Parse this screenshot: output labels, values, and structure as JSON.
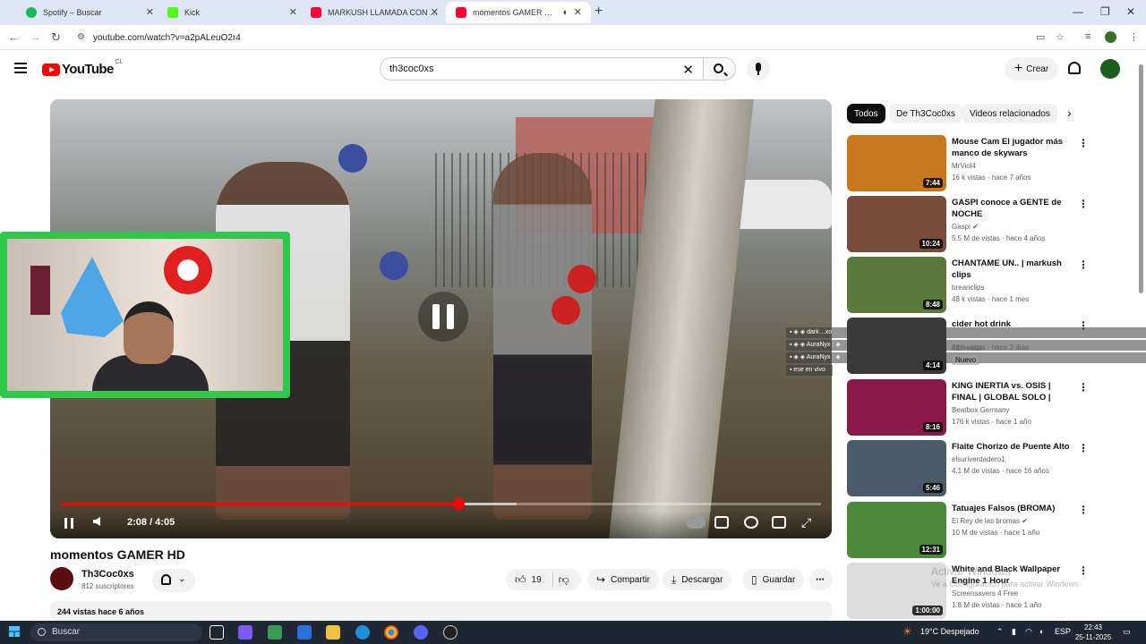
{
  "browser": {
    "tabs": [
      {
        "label": "Spotify – Buscar",
        "favicon_color": "#1db954"
      },
      {
        "label": "Kick",
        "favicon_color": "#53fc18"
      },
      {
        "label": "MARKUSH LLAMADA CON BAY",
        "favicon_color": "#ff0033"
      },
      {
        "label": "momentos GAMER HD - Yo",
        "favicon_color": "#ff0033",
        "active": true
      }
    ],
    "url": "youtube.com/watch?v=a2pALeuO2r4"
  },
  "youtube": {
    "logo_text": "YouTube",
    "country": "CL",
    "search_value": "th3coc0xs",
    "create_label": "Crear"
  },
  "player": {
    "time": "2:08 / 4:05",
    "progress_fraction": 0.523,
    "buffered_fraction": 0.6
  },
  "chat_overlay": [
    {
      "text": "▪ ◈ ◈ dark…xo"
    },
    {
      "text": "▪ ◈ ◈ AuraNyx : ◈"
    },
    {
      "text": "▪ ◈ ◈ AuraNyx : ◈"
    },
    {
      "text": "▪ ◈ ◈ AuraNyx : ◈"
    },
    {
      "text": "▪ ese en vivo"
    }
  ],
  "video": {
    "title": "momentos GAMER HD",
    "channel": "Th3Coc0xs",
    "subscribers": "812 suscriptores",
    "likes": "19",
    "share_label": "Compartir",
    "download_label": "Descargar",
    "save_label": "Guardar",
    "views_date": "244 vistas  hace 6 años"
  },
  "sidebar": {
    "chips": [
      "Todos",
      "De Th3Coc0xs",
      "Videos relacionados"
    ],
    "items": [
      {
        "title": "Mouse Cam El jugador más manco de skywars",
        "channel": "MrViol4",
        "meta": "16 k vistas · hace 7 años",
        "duration": "7:44",
        "thumb": "#c8781c"
      },
      {
        "title": "GASPI conoce a GENTE de NOCHE",
        "channel": "Gaspi ✔",
        "meta": "5.5 M de vistas · hace 4 años",
        "duration": "10:24",
        "thumb": "#7a4a3a"
      },
      {
        "title": "CHANTAME UN.. | markush clips",
        "channel": "breanclips",
        "meta": "48 k vistas · hace 1 mes",
        "duration": "8:48",
        "thumb": "#5a7a3a"
      },
      {
        "title": "cider hot drink",
        "channel": "MB metal",
        "meta": "21 k vistas · hace 3 días",
        "duration": "4:14",
        "thumb": "#3a3a3a",
        "badge": "Nuevo"
      },
      {
        "title": "KING INERTIA vs. OSIS | FINAL | GLOBAL SOLO | Germa...",
        "channel": "Beatbox Germany",
        "meta": "176 k vistas · hace 1 año",
        "duration": "8:16",
        "thumb": "#8a1a4a"
      },
      {
        "title": "Flaite Chorizo de Puente Alto",
        "channel": "elsuriverdadero1",
        "meta": "4.1 M de vistas · hace 16 años",
        "duration": "5:46",
        "thumb": "#4a5a6a"
      },
      {
        "title": "Tatuajes Falsos (BROMA)",
        "channel": "El Rey de las bromas ✔",
        "meta": "10 M de vistas · hace 1 año",
        "duration": "12:31",
        "thumb": "#4a8a3a"
      },
      {
        "title": "White and Black Wallpaper Engine 1 Hour",
        "channel": "Screensavers 4 Free",
        "meta": "1.8 M de vistas · hace 1 año",
        "duration": "1:00:00",
        "thumb": "#dcdcdc"
      }
    ]
  },
  "watermark": {
    "line1": "Activar Windows",
    "line2": "Ve a Configuración para activar Windows"
  },
  "taskbar": {
    "search_label": "Buscar",
    "weather": "19°C  Despejado",
    "lang": "ESP",
    "time": "22:43",
    "date": "25-11-2025"
  }
}
